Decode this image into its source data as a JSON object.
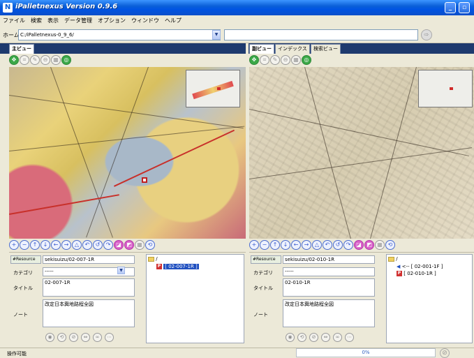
{
  "window": {
    "title": "iPalletnexus Version 0.9.6"
  },
  "menu": [
    "ファイル",
    "検索",
    "表示",
    "データ管理",
    "オプション",
    "ウィンドウ",
    "ヘルプ"
  ],
  "address": {
    "label": "ホーム",
    "value": "C:/iPalletnexus-0_9_6/"
  },
  "main_tabs": [
    "主ビュー"
  ],
  "sub_tabs": [
    "副ビュー",
    "インデックス",
    "検索ビュー"
  ],
  "icons": {
    "top": [
      "drag-icon",
      "crop-icon",
      "pencil-icon",
      "no-icon",
      "grid-icon",
      "globe-icon"
    ],
    "nav": [
      "zoom-in-icon",
      "zoom-out-icon",
      "up-icon",
      "down-icon",
      "left-icon",
      "right-icon",
      "triangle-icon",
      "rotate-left-icon",
      "rotate-ccw-icon",
      "rotate-right-icon",
      "layer-icon",
      "layers-icon",
      "grid-icon",
      "sync-icon"
    ],
    "bottom": [
      "pallet-icon",
      "sync-icon",
      "no-icon",
      "link-icon",
      "chain-icon",
      "more-icon"
    ]
  },
  "main": {
    "resource_label": "#Resource",
    "resource_value": "sekisuizu/02-007-1R",
    "category_label": "カテゴリ",
    "category_value": "-----",
    "title_label": "タイトル",
    "title_value": "02-007-1R",
    "note_label": "ノート",
    "note_value": "改定日本輿地路程全図",
    "tree_root": "/",
    "tree_items": [
      {
        "badge": "P",
        "text": "[ 02-007-1R ]",
        "selected": true
      }
    ]
  },
  "sub": {
    "resource_label": "#Resource",
    "resource_value": "sekisuizu/02-010-1R",
    "category_label": "カテゴリ",
    "category_value": "-----",
    "title_label": "タイトル",
    "title_value": "02-010-1R",
    "note_label": "ノート",
    "note_value": "改定日本輿地路程全図",
    "tree_root": "/",
    "tree_items": [
      {
        "badge": "◀",
        "text": "<-- [ 02-001-1F ]",
        "selected": false
      },
      {
        "badge": "P",
        "text": "[ 02-010-1R ]",
        "selected": false
      }
    ]
  },
  "status": {
    "text": "操作可能",
    "progress": 0,
    "progress_text": "0%"
  },
  "colors": {
    "title_blue": "#0054e3",
    "tab_strip": "#1e3a6e",
    "progress_blue": "#5fa0ff",
    "badge_red": "#d03030"
  }
}
